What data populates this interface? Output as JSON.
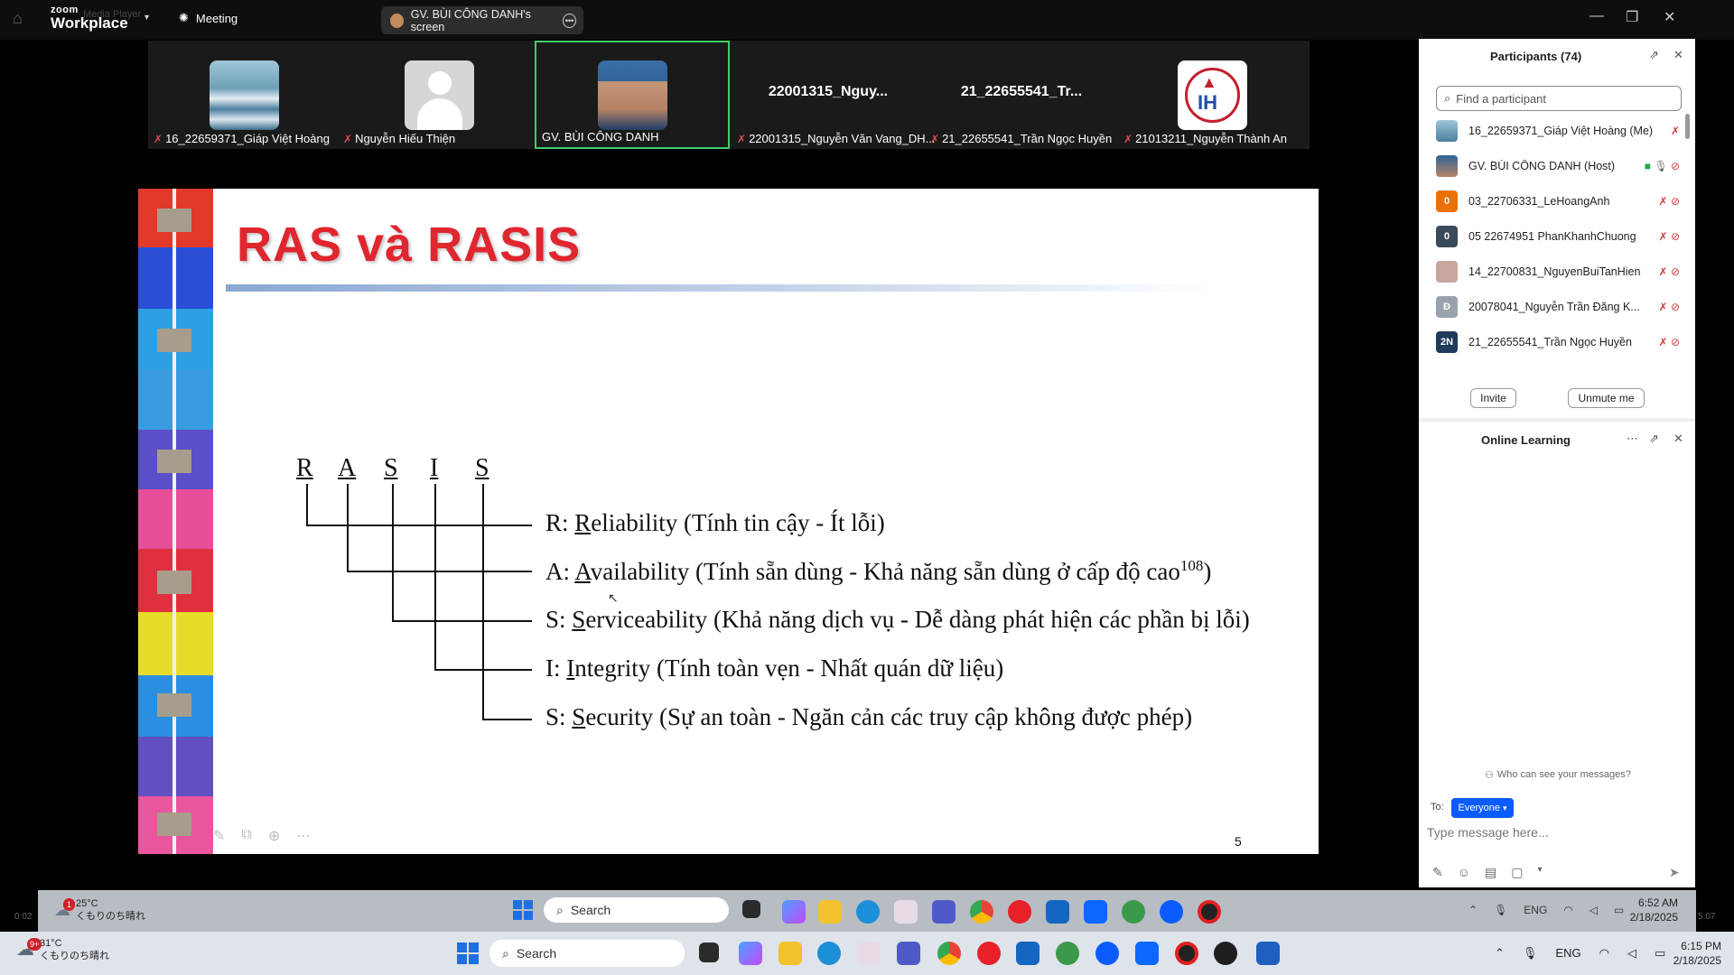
{
  "zoom": {
    "logo_top": "zoom",
    "logo_bottom": "Workplace",
    "media_player": "Media Player",
    "meeting_label": "Meeting",
    "share_label": "GV. BÙI CÔNG DANH's screen"
  },
  "video_tiles": [
    {
      "name": "16_22659371_Giáp Việt Hoàng",
      "muted": true
    },
    {
      "name": "Nguyễn Hiếu Thiện",
      "muted": true
    },
    {
      "name": "GV. BÙI CÔNG DANH",
      "muted": false,
      "active": true
    },
    {
      "big": "22001315_Nguy...",
      "name": "22001315_Nguyễn Văn Vang_DH...",
      "muted": true
    },
    {
      "big": "21_22655541_Tr...",
      "name": "21_22655541_Trần Ngọc Huyền",
      "muted": true
    },
    {
      "name": "21013211_Nguyễn Thành An",
      "muted": true
    }
  ],
  "slide": {
    "title": "RAS và RASIS",
    "letters": [
      "R",
      "A",
      "S",
      "I",
      "S"
    ],
    "rows": [
      {
        "prefix": "R: ",
        "key": "R",
        "rest": "eliability (Tính tin cậy - Ít lỗi)"
      },
      {
        "prefix": "A: ",
        "key": "A",
        "rest": "vailability (Tính sẵn dùng - Khả năng sẵn dùng ở cấp độ cao",
        "sup": "108",
        "tail": ")"
      },
      {
        "prefix": "S: ",
        "key": "S",
        "rest": "erviceability (Khả năng dịch vụ - Dễ dàng phát hiện các phần bị lỗi)"
      },
      {
        "prefix": "I: ",
        "key": "I",
        "rest": "ntegrity (Tính toàn vẹn - Nhất quán dữ liệu)"
      },
      {
        "prefix": "S: ",
        "key": "S",
        "rest": "ecurity (Sự an toàn - Ngăn cản các truy cập không được phép)"
      }
    ],
    "page_number": "5"
  },
  "participants": {
    "title": "Participants (74)",
    "search_placeholder": "Find a participant",
    "list": [
      {
        "name": "16_22659371_Giáp Việt Hoàng (Me)",
        "initials": "",
        "color": "#7fa6c8"
      },
      {
        "name": "GV. BÙI CÔNG DANH (Host)",
        "initials": "",
        "color": "#4a6a8a"
      },
      {
        "name": "03_22706331_LeHoangAnh",
        "initials": "0",
        "color": "#e8710a"
      },
      {
        "name": "05 22674951 PhanKhanhChuong",
        "initials": "0",
        "color": "#3b4a5a"
      },
      {
        "name": "14_22700831_NguyenBuiTanHien",
        "initials": "",
        "color": "#c9a5a0"
      },
      {
        "name": "20078041_Nguyễn Trần Đăng K...",
        "initials": "Đ",
        "color": "#9aa3ad"
      },
      {
        "name": "21_22655541_Trần Ngọc Huyền",
        "initials": "2N",
        "color": "#1f3a5a"
      }
    ],
    "invite": "Invite",
    "unmute": "Unmute me"
  },
  "chat": {
    "title": "Online Learning",
    "who_can_see": "Who can see your messages?",
    "to_label": "To:",
    "to_value": "Everyone",
    "placeholder": "Type message here..."
  },
  "inner_taskbar": {
    "weather_badge": "1",
    "temp": "25°C",
    "weather_text": "くもりのち晴れ",
    "search": "Search",
    "lang": "ENG",
    "time": "6:52 AM",
    "date": "2/18/2025",
    "left_time": "0:02",
    "right_time": "5:07"
  },
  "taskbar": {
    "weather_badge": "9+",
    "temp": "31°C",
    "weather_text": "くもりのち晴れ",
    "search": "Search",
    "lang": "ENG",
    "time": "6:15 PM",
    "date": "2/18/2025"
  }
}
